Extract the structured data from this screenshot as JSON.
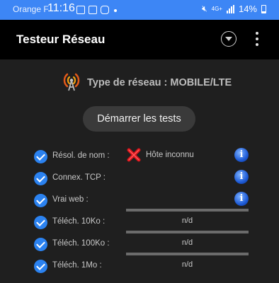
{
  "status_bar": {
    "carrier": "Orange F",
    "time": "11:16",
    "network_badge": "4G+",
    "battery": "14%"
  },
  "app_bar": {
    "title": "Testeur Réseau"
  },
  "network": {
    "label": "Type de réseau : MOBILE/LTE"
  },
  "start_button": {
    "label": "Démarrer les tests"
  },
  "tests": [
    {
      "label": "Résol. de nom :",
      "checked": true,
      "result": "Hôte inconnu",
      "status": "fail"
    },
    {
      "label": "Connex. TCP :",
      "checked": true
    },
    {
      "label": "Vrai web :",
      "checked": true
    },
    {
      "label": "Téléch. 10Ko :",
      "checked": true,
      "progress_text": "n/d",
      "progress": 0
    },
    {
      "label": "Téléch. 100Ko :",
      "checked": true,
      "progress_text": "n/d",
      "progress": 0
    },
    {
      "label": "Téléch. 1Mo :",
      "checked": true,
      "progress_text": "n/d",
      "progress": 0
    }
  ],
  "colors": {
    "status_bar": "#3d86f5",
    "app_bar": "#000000",
    "background": "#1f1f1f",
    "checkbox": "#2b82f0",
    "fail": "#d9141b"
  }
}
